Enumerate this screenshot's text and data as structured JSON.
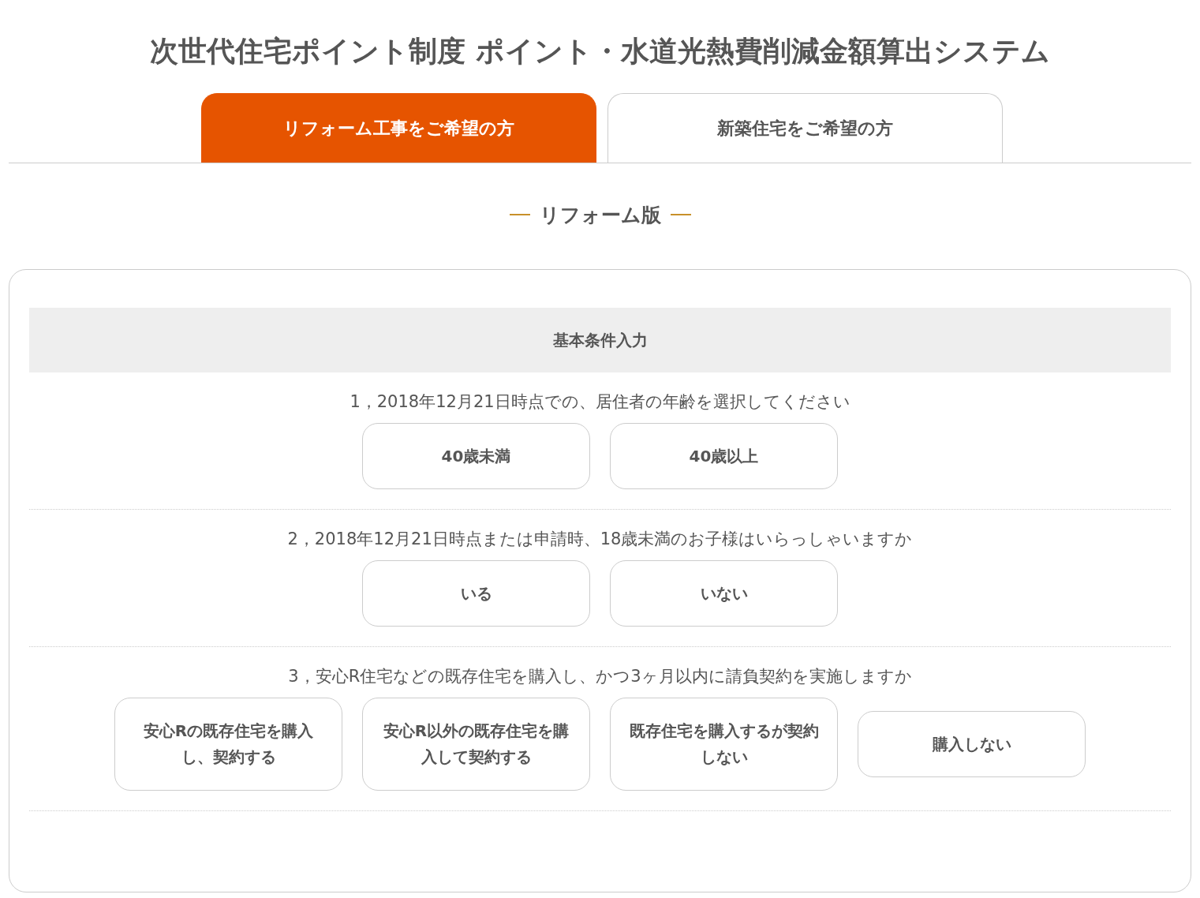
{
  "title": "次世代住宅ポイント制度 ポイント・水道光熱費削減金額算出システム",
  "tabs": [
    {
      "label": "リフォーム工事をご希望の方",
      "selected": true
    },
    {
      "label": "新築住宅をご希望の方",
      "selected": false
    }
  ],
  "subtitle": "リフォーム版",
  "section": {
    "heading": "基本条件入力",
    "questions": [
      {
        "text": "1，2018年12月21日時点での、居住者の年齢を選択してください",
        "options": [
          {
            "label": "40歳未満",
            "selected": false
          },
          {
            "label": "40歳以上",
            "selected": false
          }
        ]
      },
      {
        "text": "2，2018年12月21日時点または申請時、18歳未満のお子様はいらっしゃいますか",
        "options": [
          {
            "label": "いる",
            "selected": false
          },
          {
            "label": "いない",
            "selected": false
          }
        ]
      },
      {
        "text": "3，安心R住宅などの既存住宅を購入し、かつ3ヶ月以内に請負契約を実施しますか",
        "options": [
          {
            "label": "安心Rの既存住宅を購入し、契約する",
            "selected": false
          },
          {
            "label": "安心R以外の既存住宅を購入して契約する",
            "selected": false
          },
          {
            "label": "既存住宅を購入するが契約しない",
            "selected": false
          },
          {
            "label": "購入しない",
            "selected": false
          }
        ]
      }
    ]
  }
}
